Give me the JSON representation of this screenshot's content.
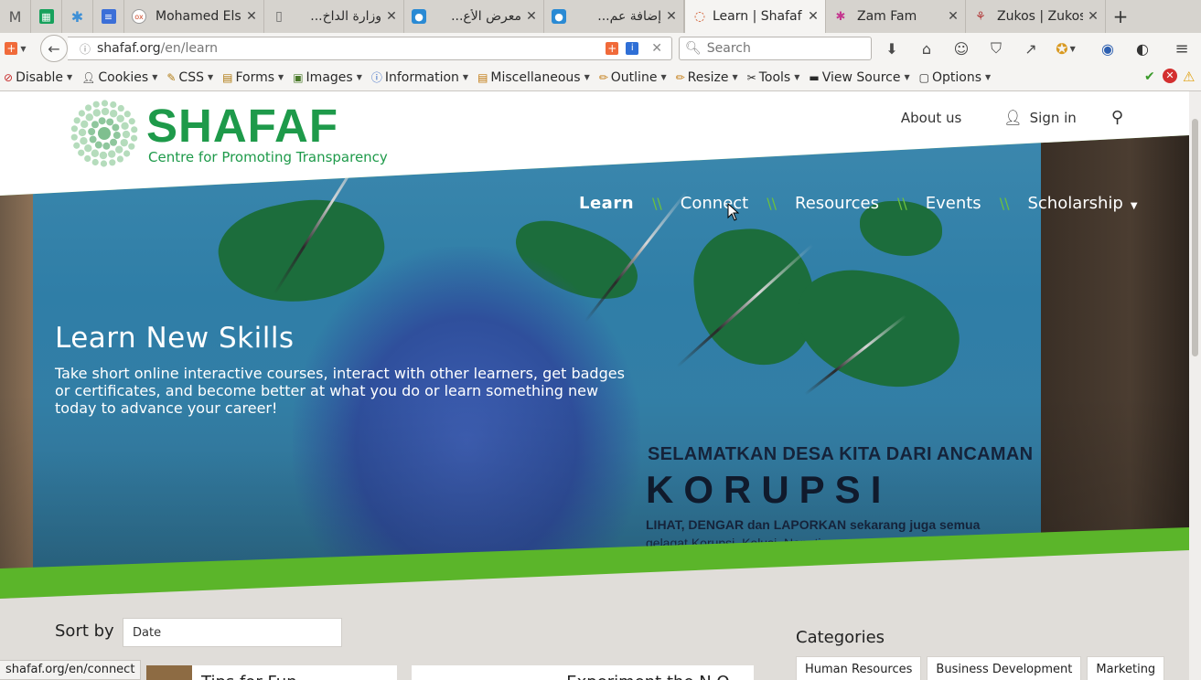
{
  "browser": {
    "tabs": [
      {
        "icon": "gmail-icon",
        "title": "",
        "pinned": true,
        "color": "#5d5d5d"
      },
      {
        "icon": "sheets-icon",
        "title": "",
        "pinned": true,
        "color": "#17a15c"
      },
      {
        "icon": "snowflake-icon",
        "title": "",
        "pinned": true,
        "color": "#3d8fd6"
      },
      {
        "icon": "docs-icon",
        "title": "",
        "pinned": true,
        "color": "#3b6fd8"
      },
      {
        "icon": "olx-icon",
        "title": "Mohamed Elsa...",
        "pinned": false
      },
      {
        "icon": "document-icon",
        "title": "وزارة الداخ...",
        "pinned": false
      },
      {
        "icon": "site-icon",
        "title": "معرض الأع...",
        "pinned": false
      },
      {
        "icon": "site-icon",
        "title": "إضافة عم...",
        "pinned": false
      },
      {
        "icon": "loading-icon",
        "title": "Learn | Shafaf",
        "pinned": false,
        "active": true
      },
      {
        "icon": "slack-icon",
        "title": "Zam Fam",
        "pinned": false
      },
      {
        "icon": "zukos-icon",
        "title": "Zukos | Zukos",
        "pinned": false
      }
    ],
    "url_host": "shafaf.org",
    "url_path": "/en/learn",
    "search_placeholder": "Search",
    "status_url": "shafaf.org/en/connect"
  },
  "devtoolbar": {
    "items": [
      {
        "label": "Disable",
        "icon": "🚫"
      },
      {
        "label": "Cookies",
        "icon": "👤"
      },
      {
        "label": "CSS",
        "icon": "✎"
      },
      {
        "label": "Forms",
        "icon": "📋"
      },
      {
        "label": "Images",
        "icon": "🖼"
      },
      {
        "label": "Information",
        "icon": "ℹ"
      },
      {
        "label": "Miscellaneous",
        "icon": "▤"
      },
      {
        "label": "Outline",
        "icon": "✏"
      },
      {
        "label": "Resize",
        "icon": "✏"
      },
      {
        "label": "Tools",
        "icon": "✂"
      },
      {
        "label": "View Source",
        "icon": "▬"
      },
      {
        "label": "Options",
        "icon": "▢"
      }
    ]
  },
  "site": {
    "brand": "SHAFAF",
    "tagline": "Centre for Promoting Transparency",
    "top_links": {
      "about": "About us",
      "signin": "Sign in"
    },
    "nav": [
      "Learn",
      "Connect",
      "Resources",
      "Events",
      "Scholarship"
    ],
    "nav_separator": "\\\\",
    "hero": {
      "title": "Learn New Skills",
      "description": "Take short online interactive courses, interact with other learners, get badges or certificates, and become better at what you do or learn something new today to advance your career!"
    },
    "poster": {
      "line1": "SELAMATKAN DESA KITA DARI ANCAMAN",
      "line2": "KORUPSI",
      "line3": "LIHAT, DENGAR dan LAPORKAN sekarang juga semua",
      "line4": "gelagat Korupsi, Kolusi, Nepotisme..."
    },
    "sort": {
      "label": "Sort by",
      "value": "Date"
    },
    "categories": {
      "title": "Categories",
      "tags": [
        "Human Resources",
        "Business Development",
        "Marketing"
      ]
    },
    "cards": [
      "Tips for Fun...",
      "Experiment the N.O..."
    ]
  },
  "colors": {
    "brand_green": "#1e9a4a",
    "accent_green": "#5bb52a"
  }
}
